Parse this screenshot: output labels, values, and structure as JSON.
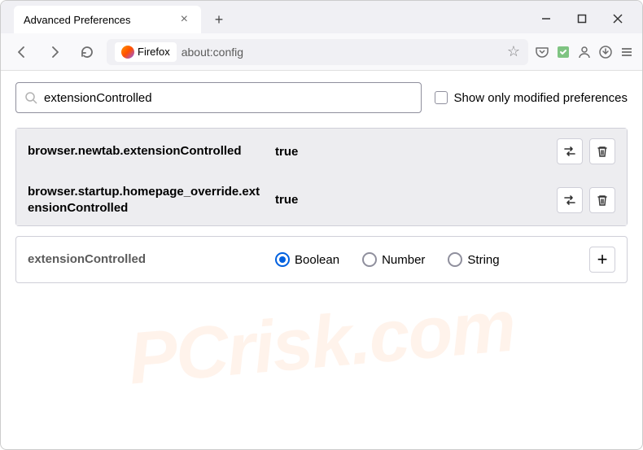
{
  "window": {
    "tab_title": "Advanced Preferences"
  },
  "toolbar": {
    "browser_label": "Firefox",
    "url": "about:config"
  },
  "search": {
    "value": "extensionControlled",
    "checkbox_label": "Show only modified preferences"
  },
  "prefs": [
    {
      "name": "browser.newtab.extensionControlled",
      "value": "true"
    },
    {
      "name": "browser.startup.homepage_override.extensionControlled",
      "value": "true"
    }
  ],
  "newpref": {
    "name": "extensionControlled",
    "types": [
      "Boolean",
      "Number",
      "String"
    ],
    "selected": "Boolean"
  },
  "watermark": "PCrisk.com"
}
